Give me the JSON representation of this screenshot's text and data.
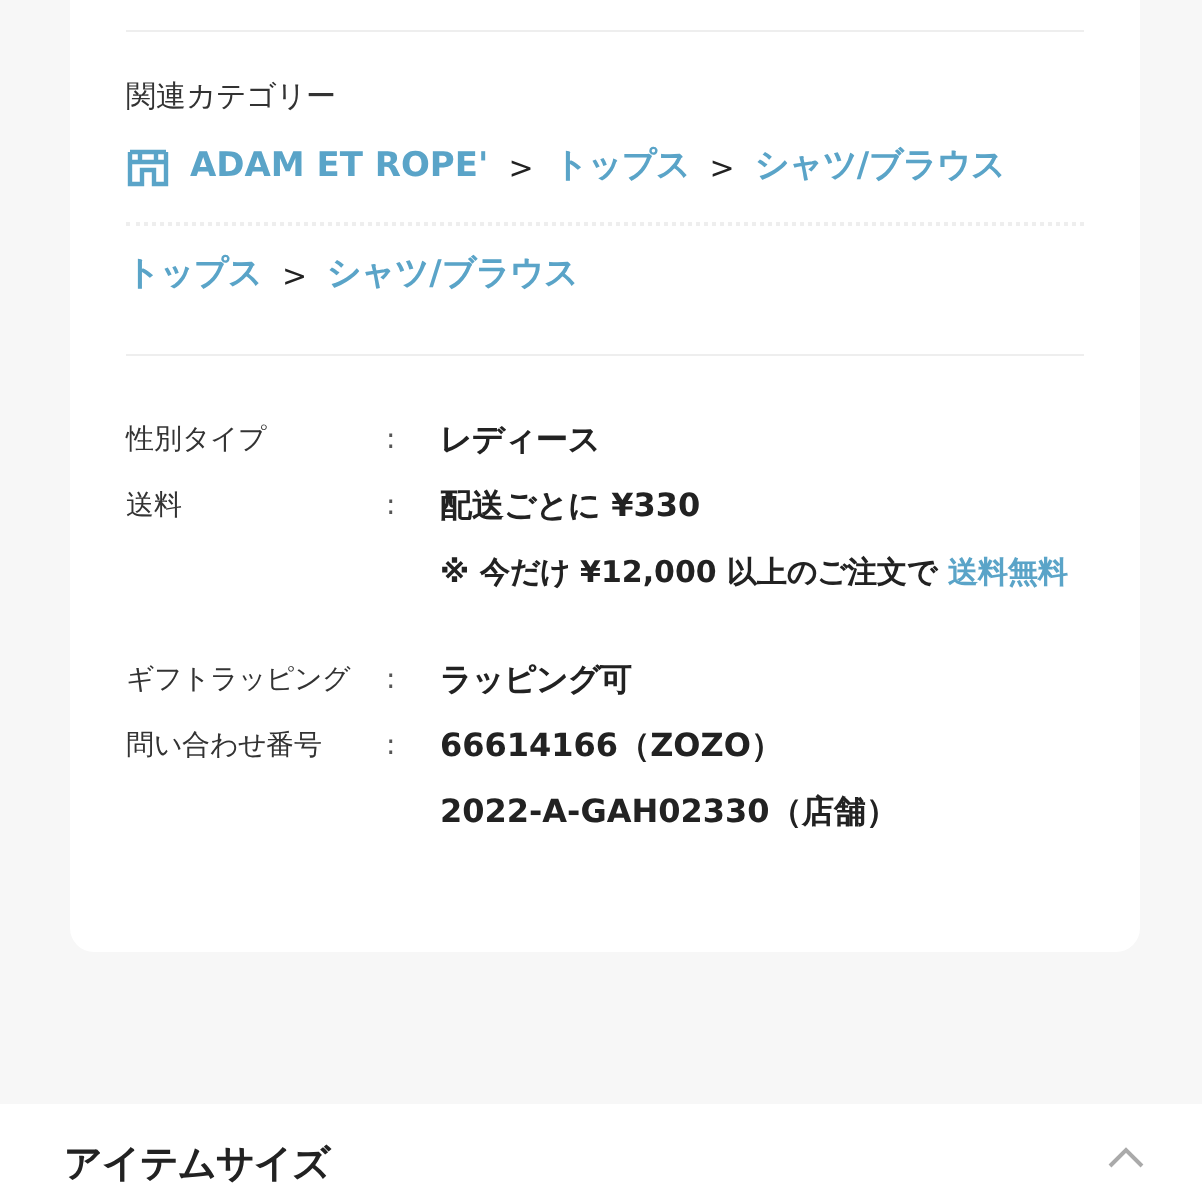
{
  "related_categories": {
    "label": "関連カテゴリー",
    "paths": [
      {
        "separator": ">",
        "items": [
          {
            "kind": "brand",
            "text": "ADAM ET ROPE'"
          },
          {
            "kind": "category",
            "text": "トップス"
          },
          {
            "kind": "category",
            "text": "シャツ/ブラウス"
          }
        ]
      },
      {
        "separator": ">",
        "items": [
          {
            "kind": "category",
            "text": "トップス"
          },
          {
            "kind": "category",
            "text": "シャツ/ブラウス"
          }
        ]
      }
    ]
  },
  "details": [
    {
      "label": "性別タイプ",
      "colon": ":",
      "values": [
        "レディース"
      ]
    },
    {
      "label": "送料",
      "colon": ":",
      "values": [
        "配送ごとに ¥330"
      ],
      "note": {
        "text": "※ 今だけ ¥12,000 以上のご注文で",
        "link": "送料無料"
      }
    },
    {
      "label": "ギフトラッピング",
      "colon": ":",
      "values": [
        "ラッピング可"
      ]
    },
    {
      "label": "問い合わせ番号",
      "colon": ":",
      "values": [
        "66614166（ZOZO）",
        "2022-A-GAH02330（店舗）"
      ]
    }
  ],
  "next_section": {
    "title": "アイテムサイズ",
    "expanded": true
  }
}
